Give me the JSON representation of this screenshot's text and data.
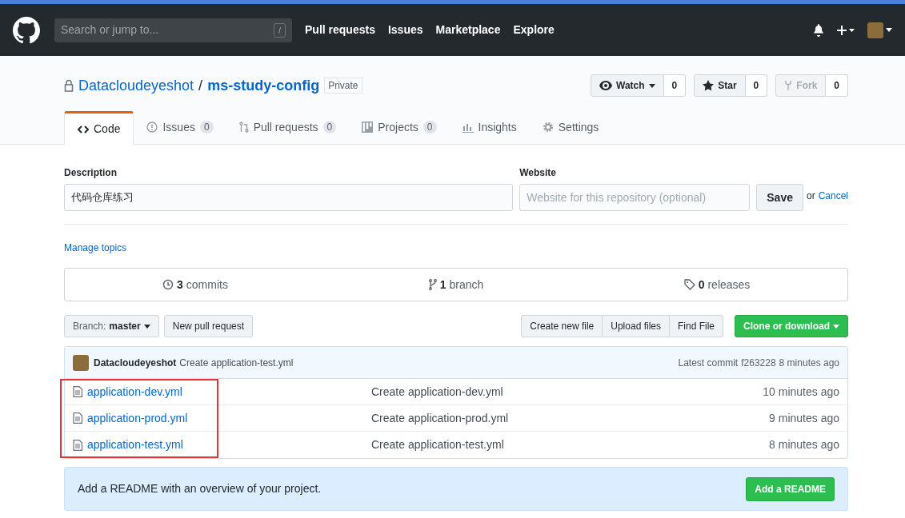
{
  "header": {
    "search_placeholder": "Search or jump to...",
    "slash_key": "/",
    "nav": [
      "Pull requests",
      "Issues",
      "Marketplace",
      "Explore"
    ]
  },
  "repo": {
    "owner": "Datacloudeyeshot",
    "separator": "/",
    "name": "ms-study-config",
    "visibility": "Private"
  },
  "social": [
    {
      "kind": "watch",
      "label": "Watch",
      "count": "0",
      "disabled": false
    },
    {
      "kind": "star",
      "label": "Star",
      "count": "0",
      "disabled": false
    },
    {
      "kind": "fork",
      "label": "Fork",
      "count": "0",
      "disabled": true
    }
  ],
  "tabs": [
    {
      "kind": "code",
      "label": "Code",
      "selected": true
    },
    {
      "kind": "issues",
      "label": "Issues",
      "count": "0",
      "selected": false
    },
    {
      "kind": "pulls",
      "label": "Pull requests",
      "count": "0",
      "selected": false
    },
    {
      "kind": "projects",
      "label": "Projects",
      "count": "0",
      "selected": false
    },
    {
      "kind": "insights",
      "label": "Insights",
      "selected": false
    },
    {
      "kind": "settings",
      "label": "Settings",
      "selected": false
    }
  ],
  "description": {
    "label": "Description",
    "value": "代码仓库练习"
  },
  "website": {
    "label": "Website",
    "placeholder": "Website for this repository (optional)"
  },
  "save_button": "Save",
  "or_text": "or",
  "cancel_link": "Cancel",
  "manage_topics": "Manage topics",
  "stats": [
    {
      "kind": "commits",
      "count": "3",
      "label": "commits"
    },
    {
      "kind": "branch",
      "count": "1",
      "label": "branch"
    },
    {
      "kind": "releases",
      "count": "0",
      "label": "releases"
    }
  ],
  "branch_button": {
    "label": "Branch:",
    "value": "master"
  },
  "new_pr": "New pull request",
  "file_actions": [
    "Create new file",
    "Upload files",
    "Find File"
  ],
  "clone_button": "Clone or download",
  "latest_commit": {
    "author": "Datacloudeyeshot",
    "message": "Create application-test.yml",
    "prefix": "Latest commit",
    "sha": "f263228",
    "time": "8 minutes ago"
  },
  "files": [
    {
      "name": "application-dev.yml",
      "message": "Create application-dev.yml",
      "age": "10 minutes ago"
    },
    {
      "name": "application-prod.yml",
      "message": "Create application-prod.yml",
      "age": "9 minutes ago"
    },
    {
      "name": "application-test.yml",
      "message": "Create application-test.yml",
      "age": "8 minutes ago"
    }
  ],
  "readme_banner": {
    "text": "Add a README with an overview of your project.",
    "button": "Add a README"
  }
}
